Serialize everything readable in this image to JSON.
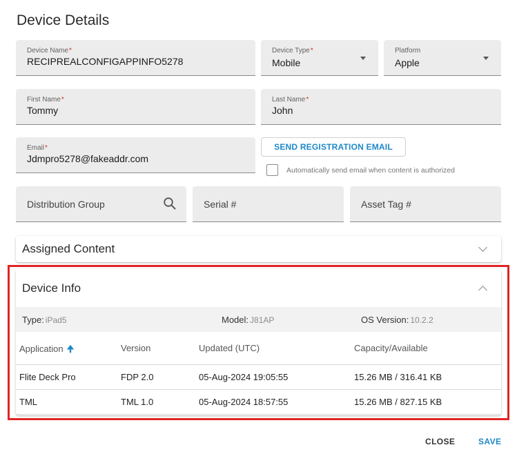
{
  "dialog": {
    "title": "Device Details"
  },
  "fields": {
    "device_name": {
      "label": "Device Name",
      "value": "RECIPREALCONFIGAPPINFO5278"
    },
    "device_type": {
      "label": "Device Type",
      "value": "Mobile"
    },
    "platform": {
      "label": "Platform",
      "value": "Apple"
    },
    "first_name": {
      "label": "First Name",
      "value": "Tommy"
    },
    "last_name": {
      "label": "Last Name",
      "value": "John"
    },
    "email": {
      "label": "Email",
      "value": "Jdmpro5278@fakeaddr.com"
    },
    "distribution_group": {
      "placeholder": "Distribution Group"
    },
    "serial": {
      "placeholder": "Serial #"
    },
    "asset_tag": {
      "placeholder": "Asset Tag #"
    }
  },
  "required_marker": "*",
  "send_registration": {
    "label": "SEND REGISTRATION EMAIL"
  },
  "auto_send": {
    "label": "Automatically send email when content is authorized",
    "checked": false
  },
  "assigned_content": {
    "title": "Assigned Content",
    "expanded": false
  },
  "device_info": {
    "title": "Device Info",
    "expanded": true,
    "type_label": "Type:",
    "type_value": "iPad5",
    "model_label": "Model:",
    "model_value": "J81AP",
    "os_label": "OS Version:",
    "os_value": "10.2.2"
  },
  "apps_table": {
    "columns": [
      "Application",
      "Version",
      "Updated (UTC)",
      "Capacity/Available"
    ],
    "sort_column": "Application",
    "rows": [
      {
        "application": "Flite Deck Pro",
        "version": "FDP 2.0",
        "updated": "05-Aug-2024 19:05:55",
        "capacity": "15.26 MB / 316.41 KB"
      },
      {
        "application": "TML",
        "version": "TML 1.0",
        "updated": "05-Aug-2024 18:57:55",
        "capacity": "15.26 MB / 827.15 KB"
      }
    ]
  },
  "footer": {
    "close_label": "CLOSE",
    "save_label": "SAVE"
  },
  "colors": {
    "accent": "#1e88c8",
    "required": "#d32f2f",
    "highlight": "#e02424",
    "field_bg": "#ececec"
  }
}
